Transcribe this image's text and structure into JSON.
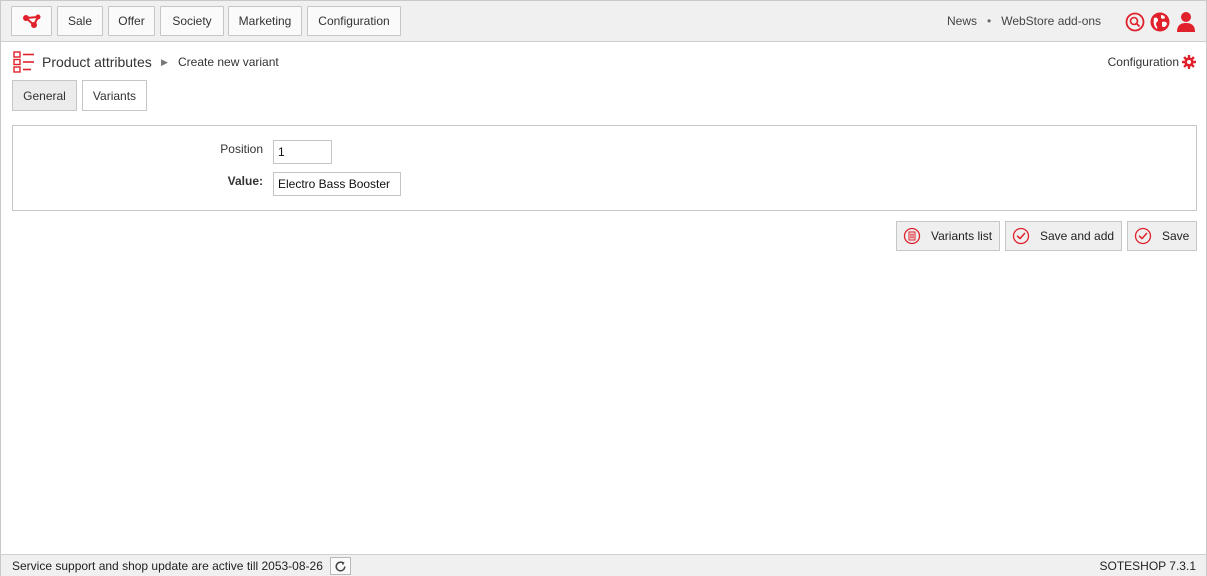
{
  "topbar": {
    "logo_icon": "share-nodes-icon",
    "nav": [
      "Sale",
      "Offer",
      "Society",
      "Marketing",
      "Configuration"
    ],
    "links": [
      "News",
      "WebStore add-ons"
    ],
    "link_separator": "•",
    "icons": [
      "search-icon",
      "globe-icon",
      "user-icon"
    ]
  },
  "breadcrumb": {
    "title": "Product attributes",
    "arrow": "▶",
    "current": "Create new variant",
    "config_label": "Configuration",
    "config_icon": "gear-icon"
  },
  "tabs": [
    "General",
    "Variants"
  ],
  "form": {
    "position_label": "Position",
    "position_value": "1",
    "value_label": "Value:",
    "value_value": "Electro Bass Booster"
  },
  "actions": {
    "list_label": "Variants list",
    "save_add_label": "Save and add",
    "save_label": "Save"
  },
  "footer": {
    "status_text": "Service support and shop update are active till 2053-08-26",
    "version": "SOTESHOP 7.3.1"
  },
  "colors": {
    "accent": "#e0202b",
    "bar_bg": "#f0f0f0",
    "border": "#c6c6c6"
  }
}
